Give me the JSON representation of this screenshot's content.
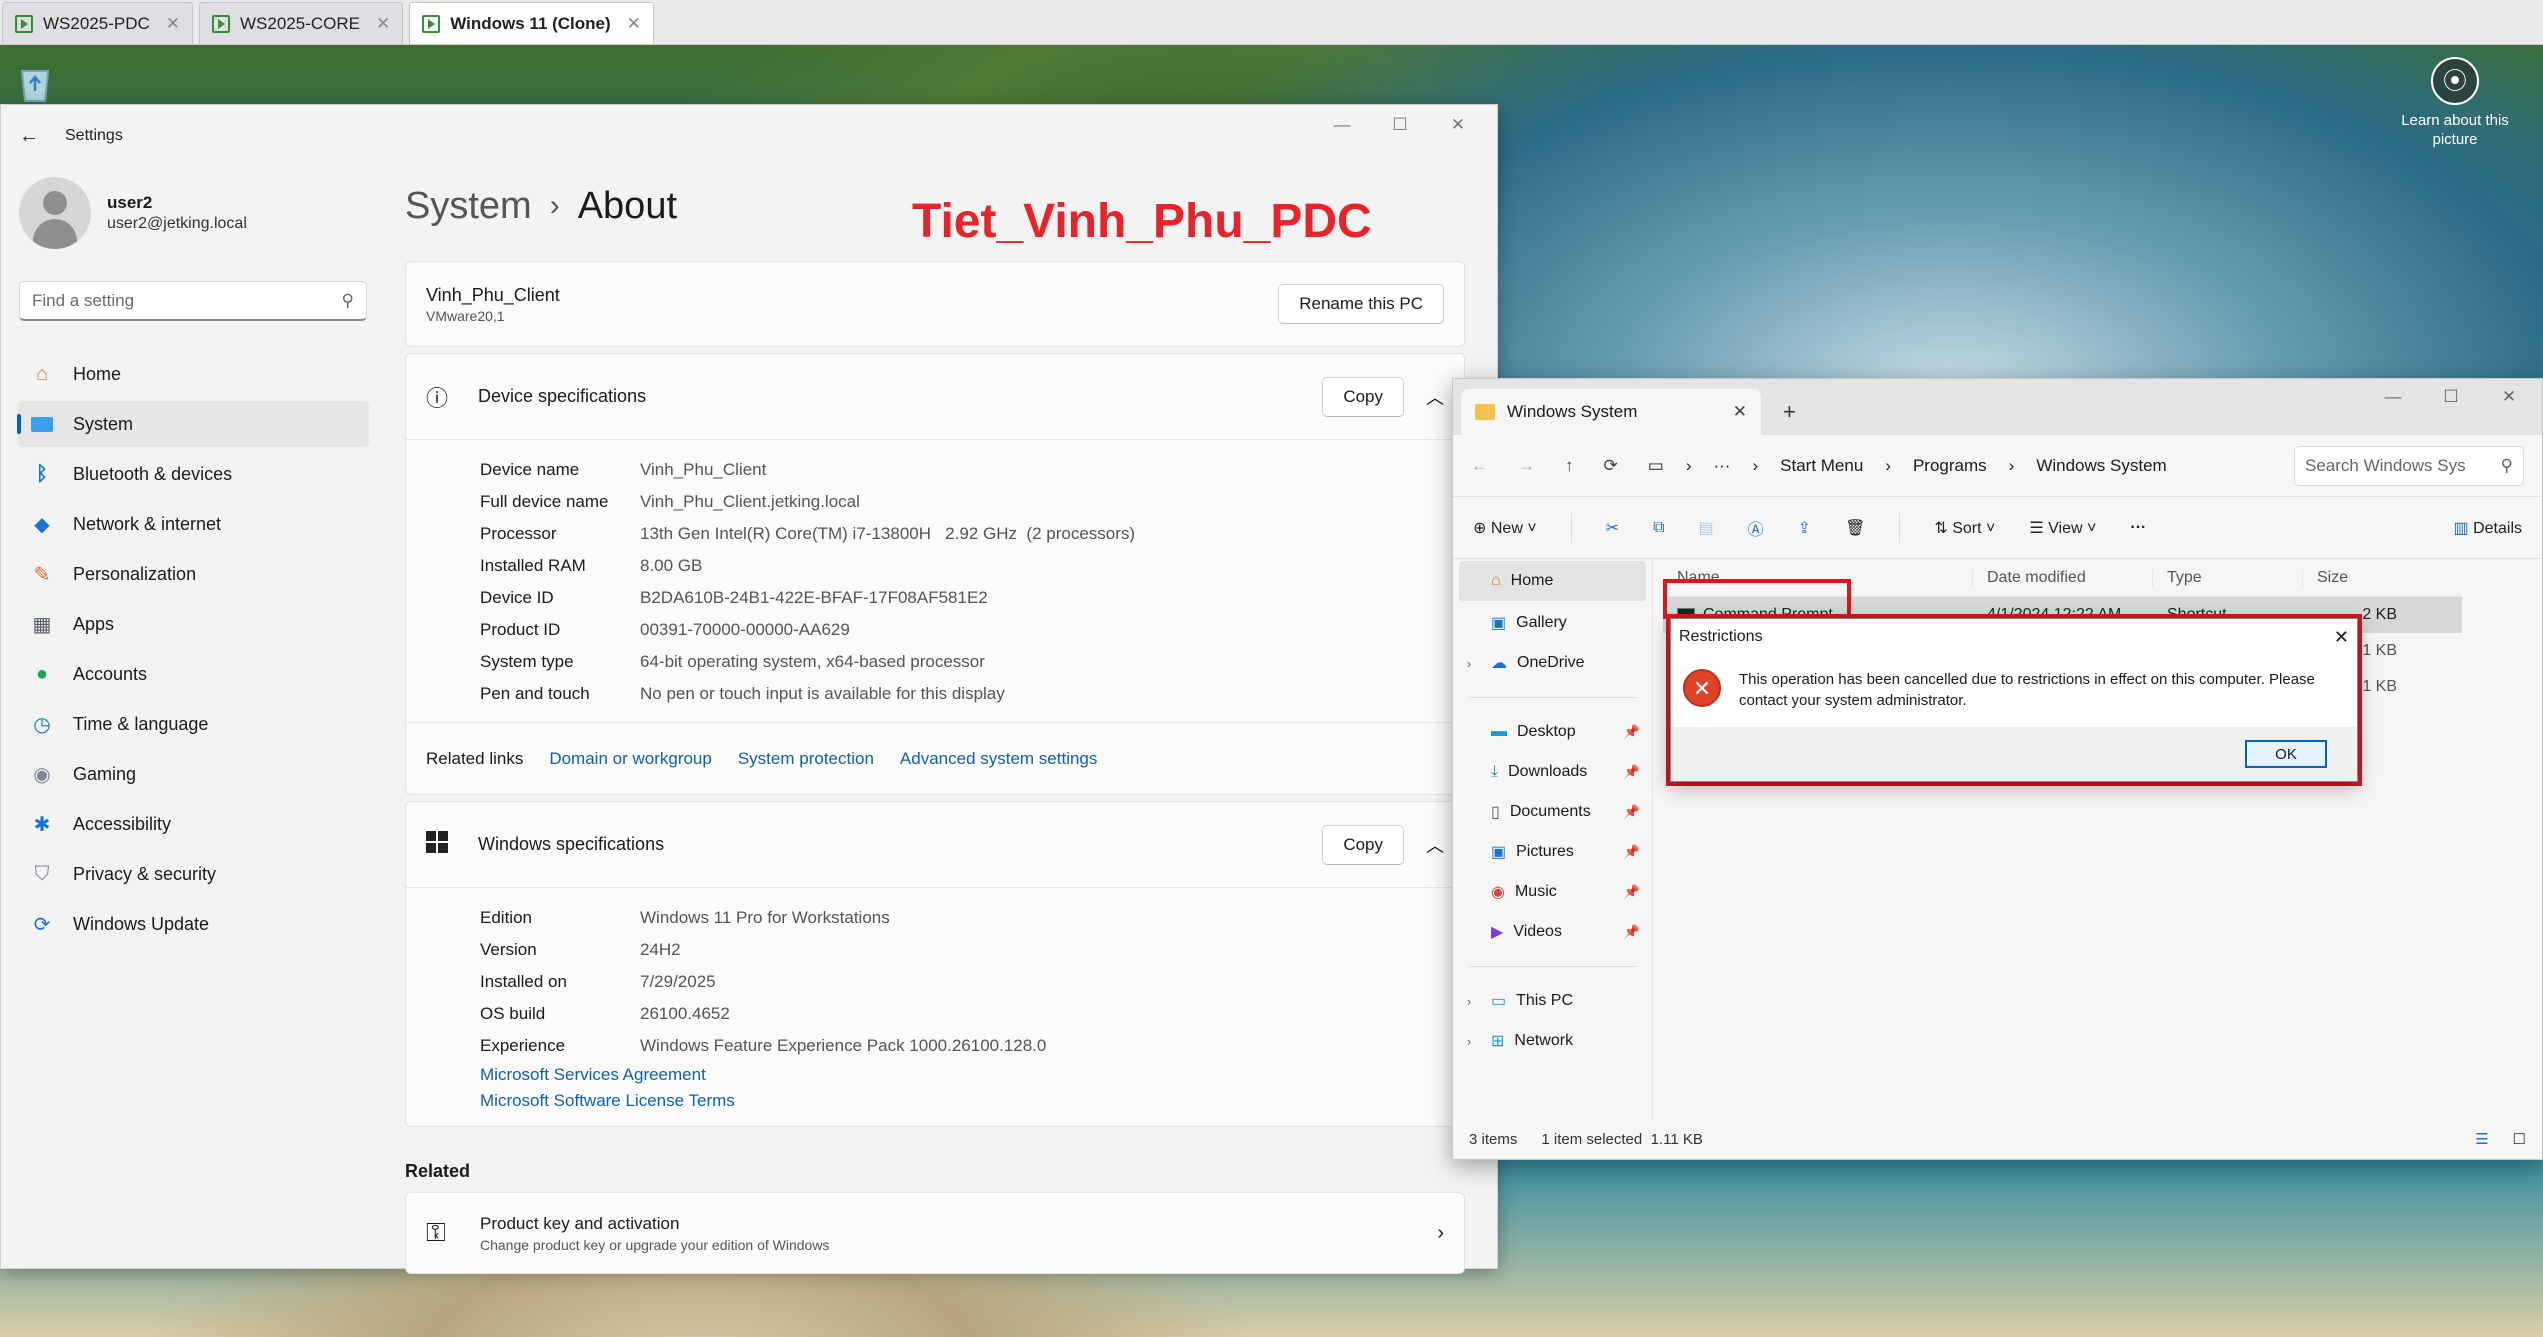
{
  "vm_tabs": [
    {
      "label": "WS2025-PDC"
    },
    {
      "label": "WS2025-CORE"
    },
    {
      "label": "Windows 11 (Clone)"
    }
  ],
  "desktop": {
    "learn_label": "Learn about this picture"
  },
  "settings": {
    "app_title": "Settings",
    "user_name": "user2",
    "user_email": "user2@jetking.local",
    "search_placeholder": "Find a setting",
    "nav": [
      {
        "label": "Home",
        "icon": "home-icon"
      },
      {
        "label": "System",
        "icon": "system-icon"
      },
      {
        "label": "Bluetooth & devices",
        "icon": "bluetooth-icon"
      },
      {
        "label": "Network & internet",
        "icon": "wifi-icon"
      },
      {
        "label": "Personalization",
        "icon": "brush-icon"
      },
      {
        "label": "Apps",
        "icon": "apps-icon"
      },
      {
        "label": "Accounts",
        "icon": "accounts-icon"
      },
      {
        "label": "Time & language",
        "icon": "globe-icon"
      },
      {
        "label": "Gaming",
        "icon": "gamepad-icon"
      },
      {
        "label": "Accessibility",
        "icon": "accessibility-icon"
      },
      {
        "label": "Privacy & security",
        "icon": "shield-icon"
      },
      {
        "label": "Windows Update",
        "icon": "update-icon"
      }
    ],
    "breadcrumb_parent": "System",
    "breadcrumb_sep": "›",
    "breadcrumb_current": "About",
    "pc_name": "Vinh_Phu_Client",
    "pc_model": "VMware20,1",
    "rename_label": "Rename this PC",
    "device_specs": {
      "title": "Device specifications",
      "copy_label": "Copy",
      "rows": [
        {
          "k": "Device name",
          "v": "Vinh_Phu_Client"
        },
        {
          "k": "Full device name",
          "v": "Vinh_Phu_Client.jetking.local"
        },
        {
          "k": "Processor",
          "v": "13th Gen Intel(R) Core(TM) i7-13800H   2.92 GHz  (2 processors)"
        },
        {
          "k": "Installed RAM",
          "v": "8.00 GB"
        },
        {
          "k": "Device ID",
          "v": "B2DA610B-24B1-422E-BFAF-17F08AF581E2"
        },
        {
          "k": "Product ID",
          "v": "00391-70000-00000-AA629"
        },
        {
          "k": "System type",
          "v": "64-bit operating system, x64-based processor"
        },
        {
          "k": "Pen and touch",
          "v": "No pen or touch input is available for this display"
        }
      ]
    },
    "related_links": {
      "label": "Related links",
      "links": [
        "Domain or workgroup",
        "System protection",
        "Advanced system settings"
      ]
    },
    "windows_specs": {
      "title": "Windows specifications",
      "copy_label": "Copy",
      "rows": [
        {
          "k": "Edition",
          "v": "Windows 11 Pro for Workstations"
        },
        {
          "k": "Version",
          "v": "24H2"
        },
        {
          "k": "Installed on",
          "v": "7/29/2025"
        },
        {
          "k": "OS build",
          "v": "26100.4652"
        },
        {
          "k": "Experience",
          "v": "Windows Feature Experience Pack 1000.26100.128.0"
        }
      ],
      "links": [
        "Microsoft Services Agreement",
        "Microsoft Software License Terms"
      ]
    },
    "related_title": "Related",
    "product_key": {
      "title": "Product key and activation",
      "subtitle": "Change product key or upgrade your edition of Windows"
    }
  },
  "overlay_title": "Tiet_Vinh_Phu_PDC",
  "explorer": {
    "tab_title": "Windows System",
    "path": [
      "Start Menu",
      "Programs",
      "Windows System"
    ],
    "search_placeholder": "Search Windows Sys",
    "toolbar": {
      "new": "New",
      "sort": "Sort",
      "view": "View",
      "details": "Details"
    },
    "nav": {
      "home": "Home",
      "gallery": "Gallery",
      "onedrive": "OneDrive",
      "desktop": "Desktop",
      "downloads": "Downloads",
      "documents": "Documents",
      "pictures": "Pictures",
      "music": "Music",
      "videos": "Videos",
      "thispc": "This PC",
      "network": "Network"
    },
    "columns": {
      "name": "Name",
      "date": "Date modified",
      "type": "Type",
      "size": "Size"
    },
    "rows": [
      {
        "name": "Command Prompt",
        "date": "4/1/2024 12:22 AM",
        "type": "Shortcut",
        "size": "2 KB"
      },
      {
        "name": "",
        "date": "",
        "type": "",
        "size": "1 KB"
      },
      {
        "name": "",
        "date": "",
        "type": "",
        "size": "1 KB"
      }
    ],
    "status_items": "3 items",
    "status_selected": "1 item selected  1.11 KB"
  },
  "dialog": {
    "title": "Restrictions",
    "message": "This operation has been cancelled due to restrictions in effect on this computer. Please contact your system administrator.",
    "ok_label": "OK"
  }
}
